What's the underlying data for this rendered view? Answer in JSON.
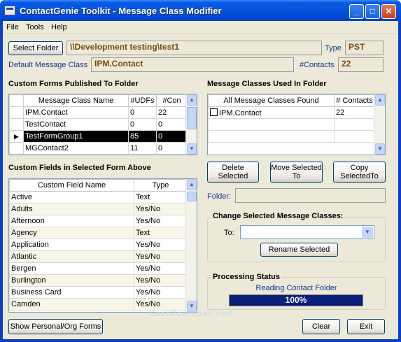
{
  "window": {
    "title": "ContactGenie Toolkit - Message Class Modifier",
    "minimize": "_",
    "maximize": "□",
    "close": "✕"
  },
  "menu": {
    "file": "File",
    "tools": "Tools",
    "help": "Help"
  },
  "folder": {
    "select_button": "Select Folder",
    "path": "\\\\Development testing\\test1",
    "type_label": "Type",
    "type_value": "PST",
    "default_class_label": "Default Message Class",
    "default_class_value": "IPM.Contact",
    "contacts_label": "#Contacts",
    "contacts_value": "22"
  },
  "custom_forms": {
    "title": "Custom Forms Published To Folder",
    "headers": [
      "Message Class Name",
      "#UDFs",
      "#Con"
    ],
    "rows": [
      {
        "name": "IPM.Contact",
        "udfs": "0",
        "con": "22"
      },
      {
        "name": "TestContact",
        "udfs": "0",
        "con": "0"
      },
      {
        "name": "TestFormGroup1",
        "udfs": "85",
        "con": "0"
      },
      {
        "name": "MGContact2",
        "udfs": "11",
        "con": "0"
      }
    ]
  },
  "message_classes": {
    "title": "Message Classes Used In Folder",
    "headers": [
      "All Message Classes Found",
      "# Contacts"
    ],
    "rows": [
      {
        "name": "IPM.Contact",
        "contacts": "22"
      }
    ]
  },
  "actions": {
    "delete": "Delete Selected",
    "move": "Move Selected To",
    "copy": "Copy SelectedTo",
    "folder_label": "Folder:"
  },
  "change_classes": {
    "title": "Change Selected Message Classes:",
    "to_label": "To:",
    "rename_button": "Rename Selected"
  },
  "custom_fields": {
    "title": "Custom Fields in Selected Form Above",
    "headers": [
      "Custom Field Name",
      "Type"
    ],
    "rows": [
      {
        "name": "Active",
        "type": "Text"
      },
      {
        "name": "Adults",
        "type": "Yes/No"
      },
      {
        "name": "Afternoon",
        "type": "Yes/No"
      },
      {
        "name": "Agency",
        "type": "Text"
      },
      {
        "name": "Application",
        "type": "Yes/No"
      },
      {
        "name": "Atlantic",
        "type": "Yes/No"
      },
      {
        "name": "Bergen",
        "type": "Yes/No"
      },
      {
        "name": "Burlington",
        "type": "Yes/No"
      },
      {
        "name": "Business Card",
        "type": "Yes/No"
      },
      {
        "name": "Camden",
        "type": "Yes/No"
      }
    ]
  },
  "status": {
    "title": "Processing Status",
    "message": "Reading Contact Folder",
    "progress_text": "100%",
    "progress_fraction": 1.0
  },
  "footer": {
    "show_forms_button": "Show Personal/Org Forms",
    "clear_button": "Clear",
    "exit_button": "Exit",
    "watermark": "GearDownload.com"
  }
}
